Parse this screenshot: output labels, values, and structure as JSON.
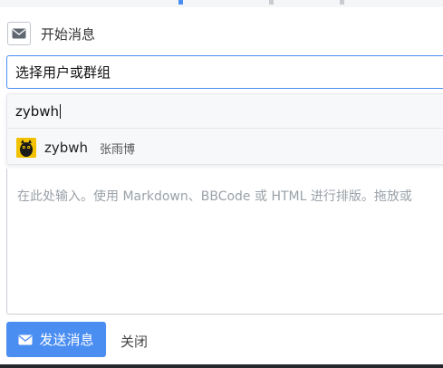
{
  "header": {
    "title": "开始消息",
    "icon": "envelope-icon"
  },
  "selector": {
    "placeholder": "选择用户或群组"
  },
  "dropdown": {
    "search_value": "zybwh",
    "options": [
      {
        "username": "zybwh",
        "real_name": "张雨博",
        "avatar": "cat-avatar"
      }
    ]
  },
  "message": {
    "placeholder": "在此处输入。使用 Markdown、BBCode 或 HTML 进行排版。拖放或"
  },
  "footer": {
    "send_label": "发送消息",
    "close_label": "关闭"
  },
  "colors": {
    "accent": "#4b8ef2",
    "placeholder_text": "#9aa1a8"
  }
}
